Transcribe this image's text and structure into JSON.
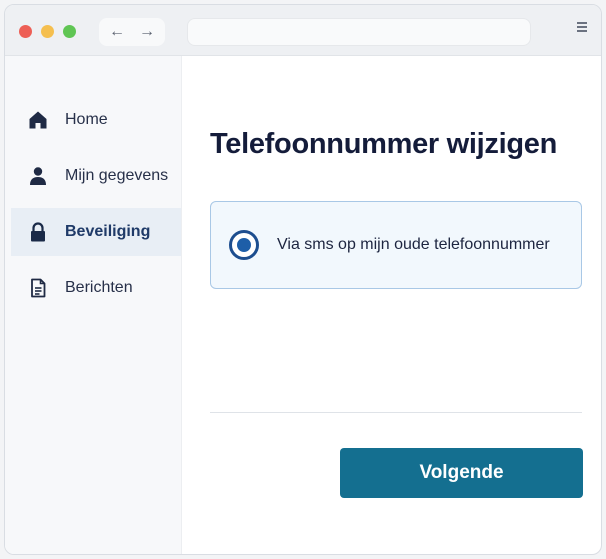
{
  "colors": {
    "accent": "#146f90",
    "radio_selected": "#1d5ea8",
    "sidebar_active_bg": "#e8eef5",
    "option_bg": "#f2f8fd",
    "option_border": "#a9c8e6"
  },
  "browser": {
    "back_icon": "arrow-left-icon",
    "forward_icon": "arrow-right-icon",
    "back_glyph": "←",
    "forward_glyph": "→",
    "url": "",
    "menu_icon": "menu-icon"
  },
  "sidebar": {
    "items": [
      {
        "label": "Home",
        "icon": "home-icon",
        "active": false
      },
      {
        "label": "Mijn gegevens",
        "icon": "user-icon",
        "active": false
      },
      {
        "label": "Beveiliging",
        "icon": "lock-icon",
        "active": true
      },
      {
        "label": "Berichten",
        "icon": "document-icon",
        "active": false
      }
    ]
  },
  "main": {
    "title": "Telefoonnummer wijzigen",
    "options": [
      {
        "label": "Via sms op mijn oude telefoonnummer",
        "selected": true
      }
    ],
    "next_button": "Volgende"
  }
}
